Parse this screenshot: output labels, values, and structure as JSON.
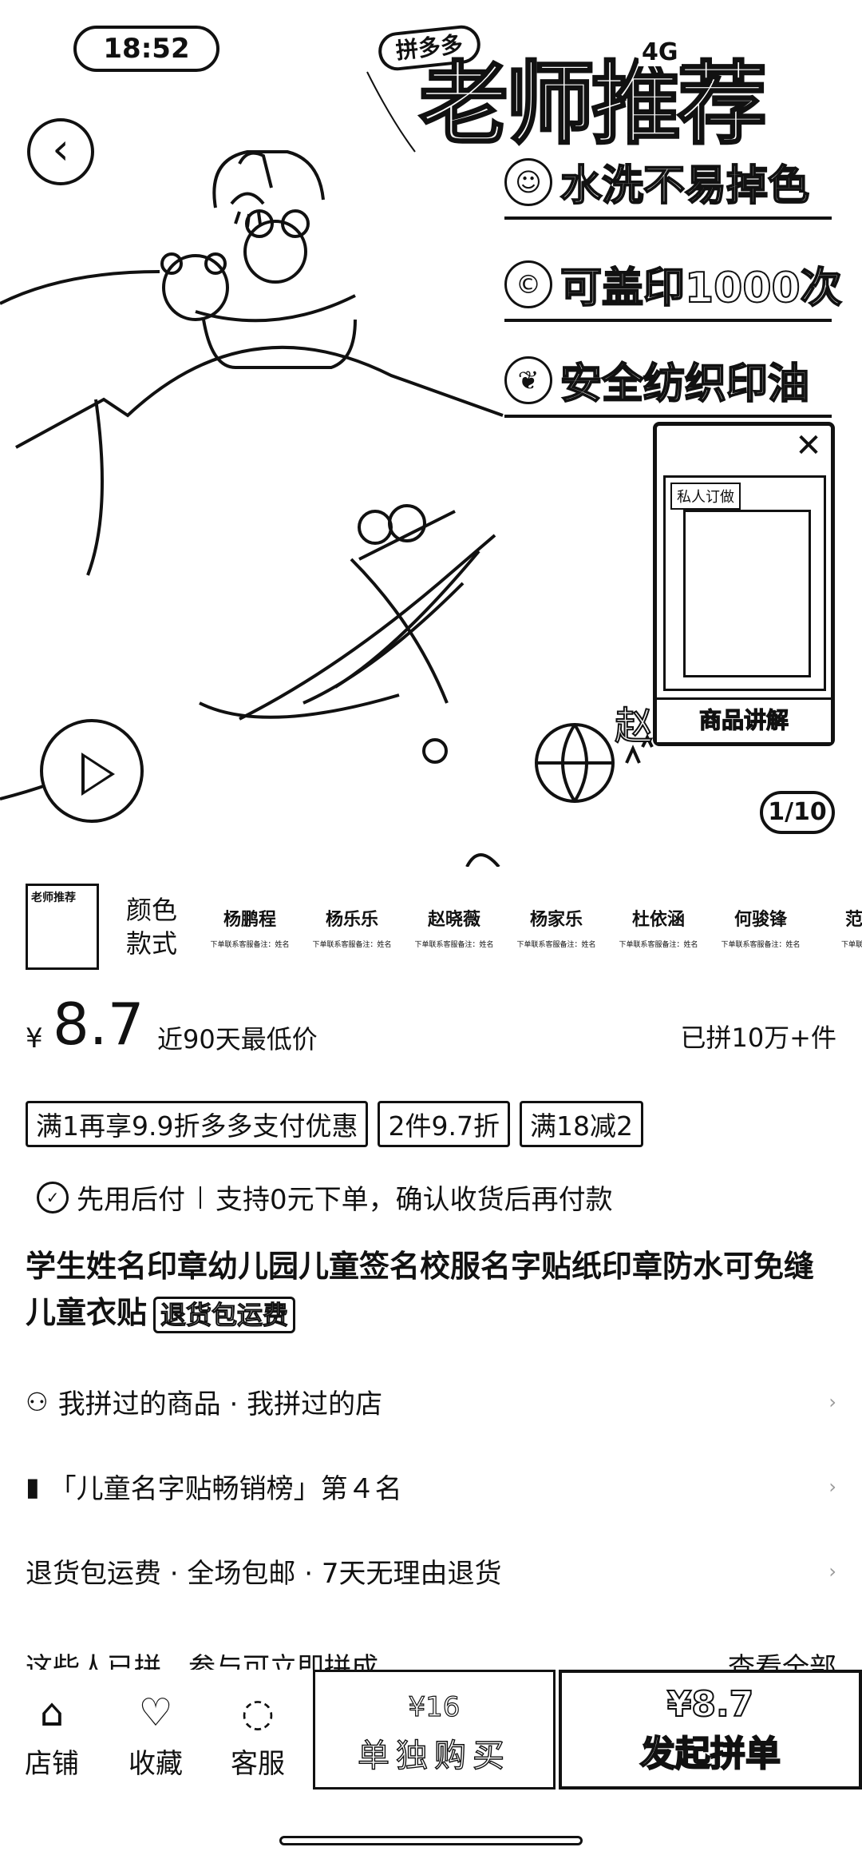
{
  "status_bar": {
    "time": "18:52",
    "network": "4G"
  },
  "hero": {
    "brand_badge": "拼多多",
    "title": "老师推荐",
    "features": [
      {
        "icon": "smile-icon",
        "glyph": "☺",
        "text": "水洗不易掉色"
      },
      {
        "icon": "stamp-count-icon",
        "glyph": "©",
        "text": "可盖印1000次"
      },
      {
        "icon": "leaf-icon",
        "glyph": "❦",
        "text": "安全纺织印油"
      }
    ],
    "page_indicator": "1/10",
    "floating_video": {
      "tag": "私人订做",
      "label": "商品讲解",
      "close": "✕"
    }
  },
  "sku": {
    "label_line1": "颜色",
    "label_line2": "款式",
    "thumb_text": "老师推荐",
    "names": [
      {
        "name": "杨鹏程",
        "sub": "下单联系客服备注：姓名"
      },
      {
        "name": "杨乐乐",
        "sub": "下单联系客服备注：姓名"
      },
      {
        "name": "赵晓薇",
        "sub": "下单联系客服备注：姓名"
      },
      {
        "name": "杨家乐",
        "sub": "下单联系客服备注：姓名"
      },
      {
        "name": "杜依涵",
        "sub": "下单联系客服备注：姓名"
      },
      {
        "name": "何骏锋",
        "sub": "下单联系客服备注：姓名"
      },
      {
        "name": "范多",
        "sub": "下单联系客服"
      }
    ]
  },
  "price": {
    "currency": "¥",
    "value": "8.7",
    "note": "近90天最低价",
    "sold": "已拼10万+件"
  },
  "promo_tags": [
    "满1再享9.9折多多支付优惠",
    "2件9.7折",
    "满18减2"
  ],
  "pay_later": {
    "label": "先用后付",
    "desc": "支持0元下单，确认收货后再付款"
  },
  "product_title": "学生姓名印章幼儿园儿童签名校服名字贴纸印章防水可免缝儿童衣贴",
  "title_badge": "退货包运费",
  "info_rows": [
    {
      "icon": "people-icon",
      "glyph": "⚇",
      "text": "我拼过的商品 · 我拼过的店"
    },
    {
      "icon": "rank-icon",
      "glyph": "▮",
      "text": "「儿童名字贴畅销榜」第４名"
    },
    {
      "icon": "",
      "glyph": "",
      "text": "退货包运费 · 全场包邮 · 7天无理由退货"
    }
  ],
  "partial_row": {
    "left": "这些人已拼，参与可立即拼成",
    "right": "查看全部"
  },
  "bottom_bar": {
    "shop": "店铺",
    "favorite": "收藏",
    "service": "客服",
    "single_price": "¥16",
    "single_label": "单独购买",
    "group_price": "¥8.7",
    "group_label": "发起拼单"
  }
}
